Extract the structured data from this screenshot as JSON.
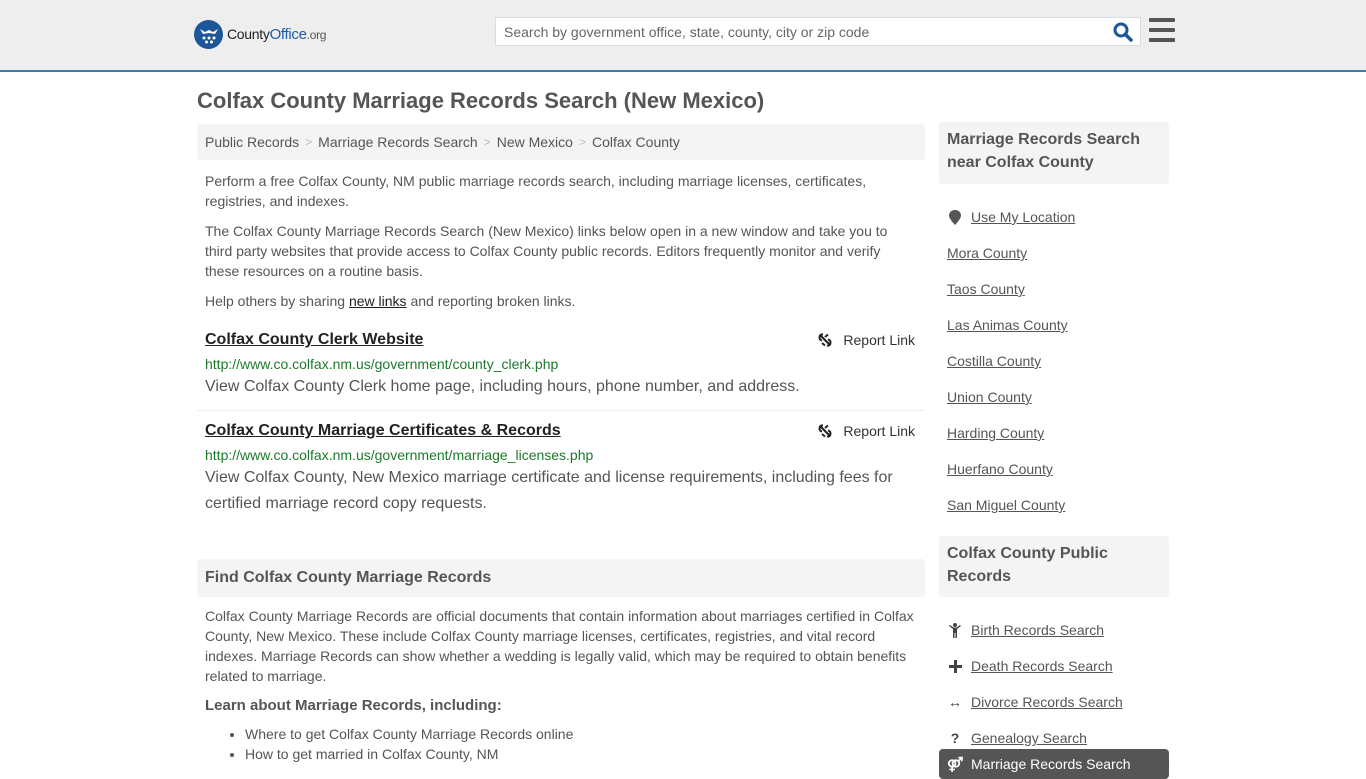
{
  "header": {
    "logo": {
      "county": "County",
      "office": "Office",
      "org": ".org",
      "icon": "eagle-stars-icon"
    },
    "search": {
      "placeholder": "Search by government office, state, county, city or zip code",
      "value": "",
      "icon": "search-icon"
    },
    "menu_icon": "hamburger-menu-icon",
    "colors": {
      "brand": "#1e5799",
      "accent_border": "#3a7cad"
    }
  },
  "page": {
    "title": "Colfax County Marriage Records Search (New Mexico)",
    "breadcrumb": [
      "Public Records",
      "Marriage Records Search",
      "New Mexico",
      "Colfax County"
    ],
    "intro": {
      "p1": "Perform a free Colfax County, NM public marriage records search, including marriage licenses, certificates, registries, and indexes.",
      "p2": "The Colfax County Marriage Records Search (New Mexico) links below open in a new window and take you to third party websites that provide access to Colfax County public records. Editors frequently monitor and verify these resources on a routine basis.",
      "p3_before": "Help others by sharing ",
      "p3_link": "new links",
      "p3_after": " and reporting broken links."
    },
    "links": [
      {
        "title": "Colfax County Clerk Website",
        "url": "http://www.co.colfax.nm.us/government/county_clerk.php",
        "description": "View Colfax County Clerk home page, including hours, phone number, and address.",
        "report_label": "Report Link"
      },
      {
        "title": "Colfax County Marriage Certificates & Records",
        "url": "http://www.co.colfax.nm.us/government/marriage_licenses.php",
        "description": "View Colfax County, New Mexico marriage certificate and license requirements, including fees for certified marriage record copy requests.",
        "report_label": "Report Link"
      }
    ],
    "find_section": {
      "heading": "Find Colfax County Marriage Records",
      "body": "Colfax County Marriage Records are official documents that contain information about marriages certified in Colfax County, New Mexico. These include Colfax County marriage licenses, certificates, registries, and vital record indexes. Marriage Records can show whether a wedding is legally valid, which may be required to obtain benefits related to marriage.",
      "learn_heading": "Learn about Marriage Records, including:",
      "learn_items": [
        "Where to get Colfax County Marriage Records online",
        "How to get married in Colfax County, NM"
      ]
    }
  },
  "sidebar": {
    "near": {
      "heading": "Marriage Records Search near Colfax County",
      "use_location": "Use My Location",
      "counties": [
        "Mora County",
        "Taos County",
        "Las Animas County",
        "Costilla County",
        "Union County",
        "Harding County",
        "Huerfano County",
        "San Miguel County"
      ]
    },
    "public_records": {
      "heading": "Colfax County Public Records",
      "items": [
        {
          "label": "Birth Records Search",
          "icon": "child-icon",
          "glyph": "🯅"
        },
        {
          "label": "Death Records Search",
          "icon": "plus-cross-icon",
          "glyph": "✚"
        },
        {
          "label": "Divorce Records Search",
          "icon": "arrows-horizontal-icon",
          "glyph": "↔"
        },
        {
          "label": "Genealogy Search",
          "icon": "question-icon",
          "glyph": "?"
        }
      ],
      "active": {
        "label": "Marriage Records Search",
        "icon": "gender-symbols-icon",
        "glyph": "⚤"
      }
    }
  }
}
